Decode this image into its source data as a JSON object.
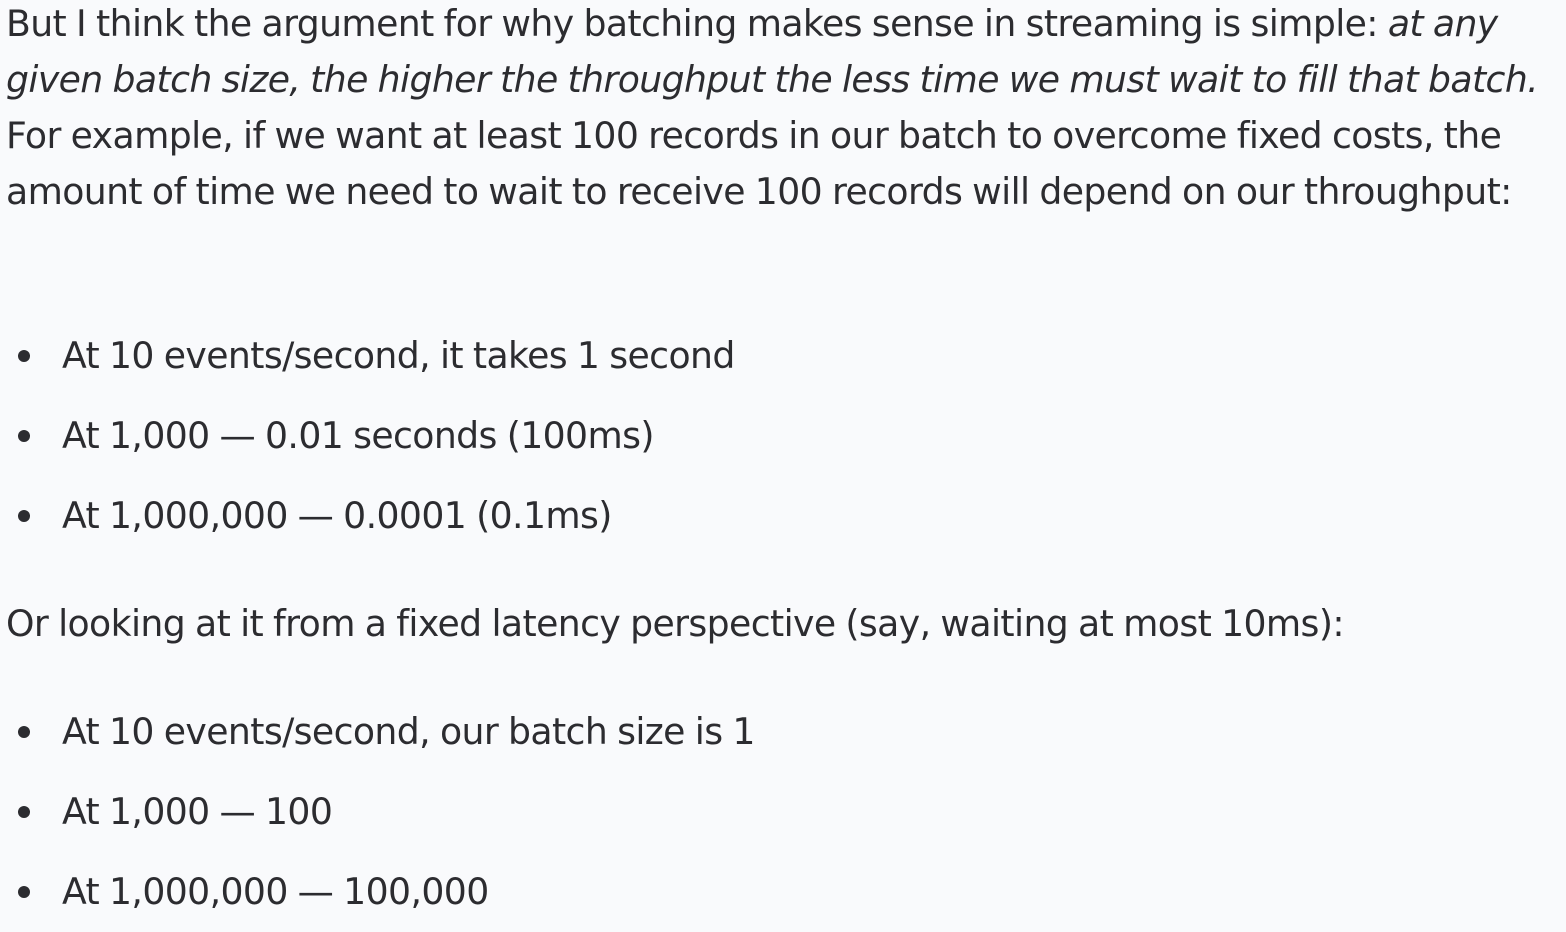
{
  "paragraph1": {
    "lead": "But I think the argument for why batching makes sense in streaming is simple: ",
    "emphasis": "at any given batch size, the higher the throughput the less time we must wait to fill that batch.",
    "rest": " For example, if we want at least 100 records in our batch to overcome fixed costs, the amount of time we need to wait to receive 100 records will depend on our throughput:"
  },
  "list1": [
    "At 10 events/second, it takes 1 second",
    "At 1,000 — 0.01 seconds (100ms)",
    "At 1,000,000 — 0.0001 (0.1ms)"
  ],
  "paragraph2": "Or looking at it from a fixed latency perspective (say, waiting at most 10ms):",
  "list2": [
    "At 10 events/second, our batch size is 1",
    "At 1,000 — 100",
    "At 1,000,000 — 100,000"
  ]
}
